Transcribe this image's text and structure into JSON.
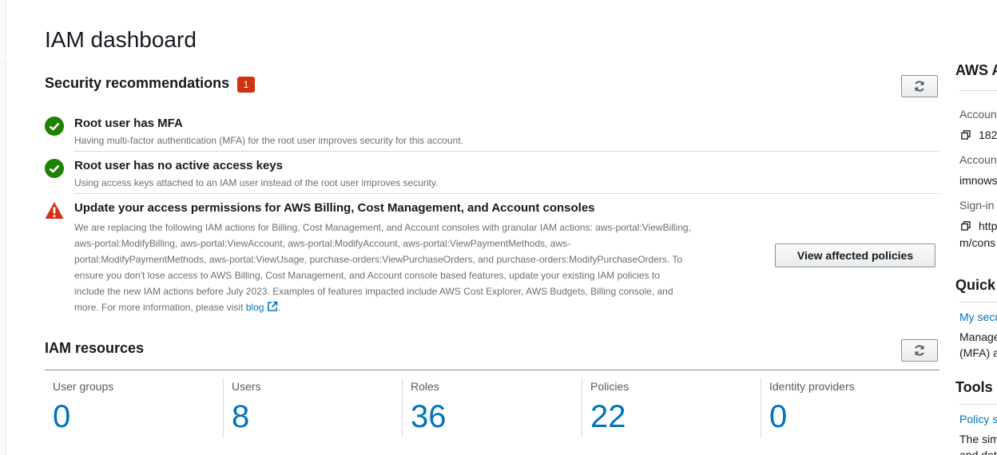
{
  "page": {
    "title": "IAM dashboard"
  },
  "security": {
    "title": "Security recommendations",
    "badge": "1",
    "items": [
      {
        "status": "success",
        "title": "Root user has MFA",
        "description": "Having multi-factor authentication (MFA) for the root user improves security for this account."
      },
      {
        "status": "success",
        "title": "Root user has no active access keys",
        "description": "Using access keys attached to an IAM user instead of the root user improves security."
      },
      {
        "status": "warning",
        "title": "Update your access permissions for AWS Billing, Cost Management, and Account consoles",
        "description": "We are replacing the following IAM actions for Billing, Cost Management, and Account consoles with granular IAM actions: aws-portal:ViewBilling,\naws-portal:ModifyBilling, aws-portal:ViewAccount, aws-portal:ModifyAccount, aws-portal:ViewPaymentMethods, aws-\nportal:ModifyPaymentMethods, aws-portal:ViewUsage, purchase-orders:ViewPurchaseOrders, and purchase-orders:ModifyPurchaseOrders. To\nensure you don't lose access to AWS Billing, Cost Management, and Account console based features, update your existing IAM policies to\ninclude the new IAM actions before July 2023. Examples of features impacted include AWS Cost Explorer, AWS Budgets, Billing console, and\nmore. For more information, please visit ",
        "link_label": "blog",
        "trailing": ".",
        "button_label": "View affected policies"
      }
    ]
  },
  "resources": {
    "title": "IAM resources",
    "items": [
      {
        "label": "User groups",
        "count": "0"
      },
      {
        "label": "Users",
        "count": "8"
      },
      {
        "label": "Roles",
        "count": "36"
      },
      {
        "label": "Policies",
        "count": "22"
      },
      {
        "label": "Identity providers",
        "count": "0"
      }
    ]
  },
  "right_panel": {
    "account_heading": "AWS A",
    "account_id_label": "Accoun",
    "account_id_value": "182",
    "account_alias_label": "Accoun",
    "account_alias_value": "imnows",
    "signin_label": "Sign-in",
    "signin_value_line1": "http",
    "signin_value_line2": "m/cons",
    "quick_heading": "Quick",
    "quick_link": "My secu",
    "quick_desc_line1": "Manage",
    "quick_desc_line2": "(MFA) a",
    "tools_heading": "Tools",
    "tools_link": "Policy s",
    "tools_desc_line1": "The sim",
    "tools_desc_line2": "and det"
  },
  "colors": {
    "success": "#1d8102",
    "warning": "#d13212",
    "link": "#0073bb",
    "badge": "#d13212"
  }
}
